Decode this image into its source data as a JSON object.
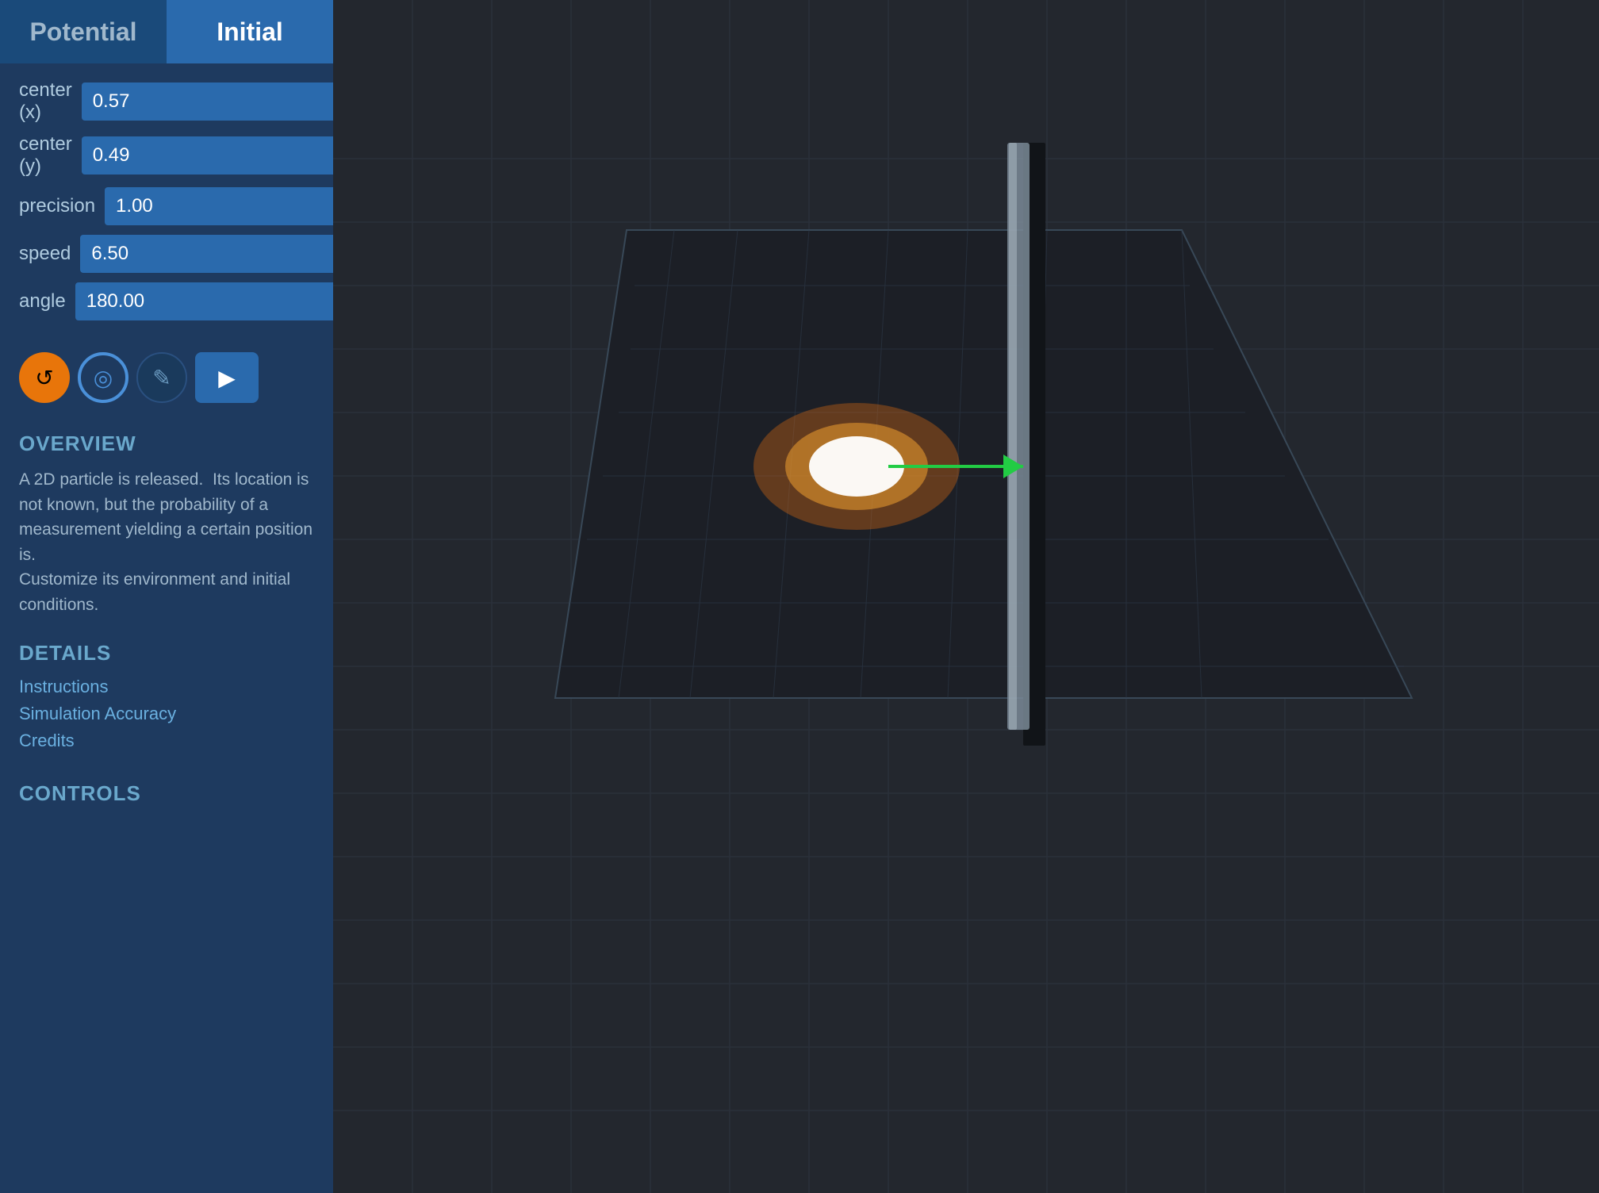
{
  "tabs": [
    {
      "id": "potential",
      "label": "Potential",
      "active": false
    },
    {
      "id": "initial",
      "label": "Initial",
      "active": true
    }
  ],
  "fields": [
    {
      "id": "center-x",
      "label": "center (x)",
      "value": "0.57"
    },
    {
      "id": "center-y",
      "label": "center (y)",
      "value": "0.49"
    },
    {
      "id": "precision",
      "label": "precision",
      "value": "1.00"
    },
    {
      "id": "speed",
      "label": "speed",
      "value": "6.50"
    },
    {
      "id": "angle",
      "label": "angle",
      "value": "180.00"
    }
  ],
  "controls": [
    {
      "id": "reset-btn",
      "label": "↺",
      "type": "orange"
    },
    {
      "id": "circle-btn",
      "label": "◎",
      "type": "blue-ring"
    },
    {
      "id": "edit-btn",
      "label": "✎",
      "type": "dark"
    },
    {
      "id": "play-btn",
      "label": "▶",
      "type": "play"
    }
  ],
  "overview": {
    "title": "OVERVIEW",
    "text": "A 2D particle is released.  Its location is not known, but the probability of a measurement yielding a certain position is.\nCustomize its environment and initial conditions."
  },
  "details": {
    "title": "DETAILS",
    "links": [
      {
        "id": "instructions-link",
        "label": "Instructions"
      },
      {
        "id": "simulation-accuracy-link",
        "label": "Simulation Accuracy"
      },
      {
        "id": "credits-link",
        "label": "Credits"
      }
    ]
  },
  "controls_section": {
    "title": "CONTROLS"
  },
  "colors": {
    "sidebar_bg": "#1e3a5f",
    "tab_active_bg": "#2a6aad",
    "tab_inactive_bg": "#1a4a7a",
    "field_bg": "#2a6aad",
    "viewport_bg": "#23272e"
  }
}
